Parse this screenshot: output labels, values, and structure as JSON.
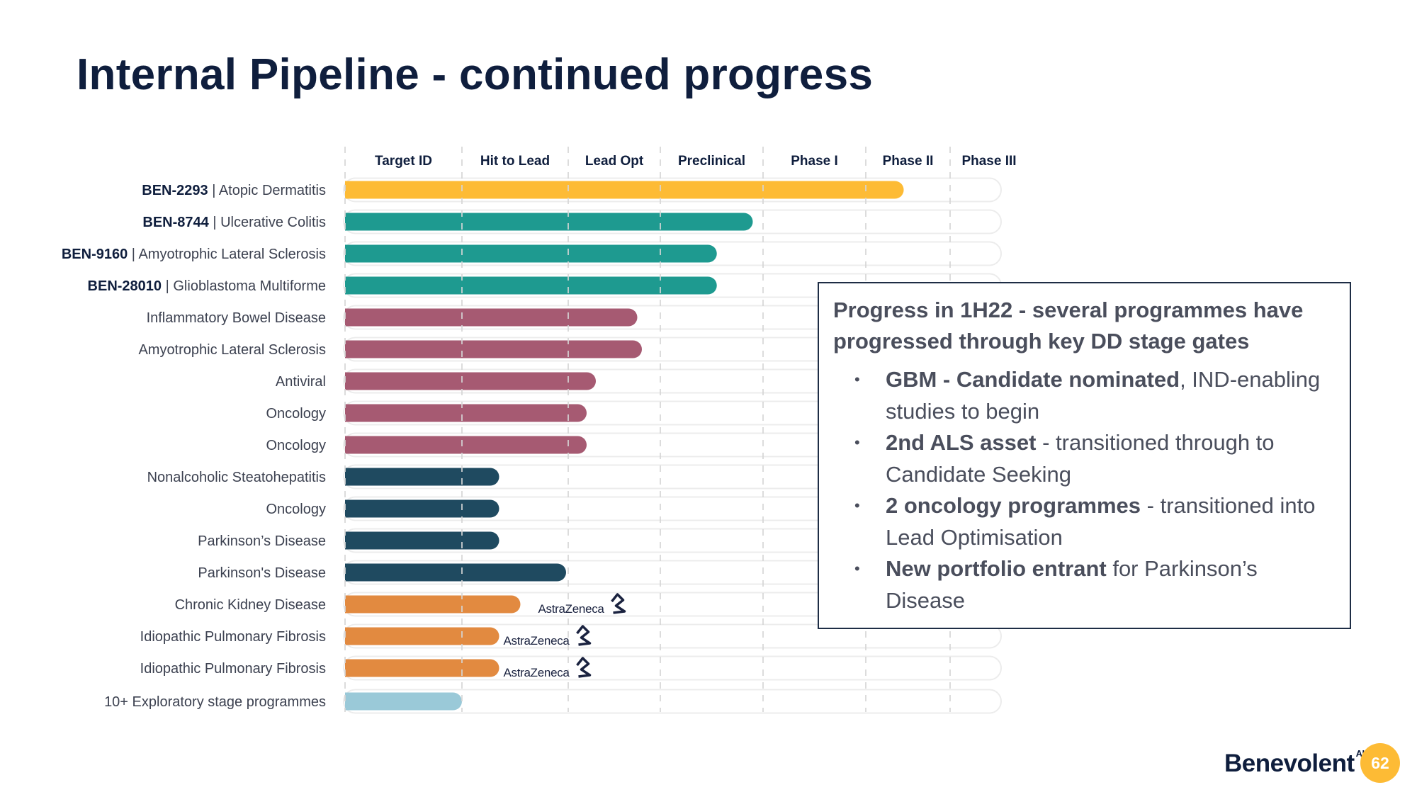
{
  "page": {
    "title": "Internal Pipeline - continued progress",
    "page_number": "62",
    "logo": {
      "name": "Benevolent",
      "superscript": "AI"
    }
  },
  "colors": {
    "title": "#0f1e3d",
    "yellow": "#fdbb35",
    "teal": "#1e9a90",
    "mauve": "#a65a72",
    "navy": "#1f4a60",
    "orange": "#e28a40",
    "lightblue": "#9ac9d8",
    "track": "#ececec",
    "grid": "#d6d6d6"
  },
  "chart_data": {
    "type": "bar",
    "orientation": "horizontal",
    "title": "",
    "stages": [
      "Target ID",
      "Hit to Lead",
      "Lead Opt",
      "Preclinical",
      "Phase I",
      "Phase II",
      "Phase III"
    ],
    "value_unit": "stage progress (0 = start of Target ID, 7 = end of Phase III)",
    "xlim": [
      0,
      7
    ],
    "grid": "dashed vertical lines at stage boundaries",
    "rows": [
      {
        "code": "BEN-2293",
        "label": "Atopic Dermatitis",
        "progress": 5.45,
        "color": "yellow",
        "partner": ""
      },
      {
        "code": "BEN-8744",
        "label": "Ulcerative Colitis",
        "progress": 3.9,
        "color": "teal",
        "partner": ""
      },
      {
        "code": "BEN-9160",
        "label": "Amyotrophic Lateral Sclerosis",
        "progress": 3.55,
        "color": "teal",
        "partner": ""
      },
      {
        "code": "BEN-28010",
        "label": "Glioblastoma Multiforme",
        "progress": 3.55,
        "color": "teal",
        "partner": ""
      },
      {
        "code": "",
        "label": "Inflammatory Bowel Disease",
        "progress": 2.75,
        "color": "mauve",
        "partner": ""
      },
      {
        "code": "",
        "label": "Amyotrophic Lateral Sclerosis",
        "progress": 2.8,
        "color": "mauve",
        "partner": ""
      },
      {
        "code": "",
        "label": "Antiviral",
        "progress": 2.3,
        "color": "mauve",
        "partner": ""
      },
      {
        "code": "",
        "label": "Oncology",
        "progress": 2.2,
        "color": "mauve",
        "partner": ""
      },
      {
        "code": "",
        "label": "Oncology",
        "progress": 2.2,
        "color": "mauve",
        "partner": ""
      },
      {
        "code": "",
        "label": "Nonalcoholic Steatohepatitis",
        "progress": 1.35,
        "color": "navy",
        "partner": ""
      },
      {
        "code": "",
        "label": "Oncology",
        "progress": 1.35,
        "color": "navy",
        "partner": ""
      },
      {
        "code": "",
        "label": "Parkinson’s Disease",
        "progress": 1.35,
        "color": "navy",
        "partner": ""
      },
      {
        "code": "",
        "label": "Parkinson's Disease",
        "progress": 1.98,
        "color": "navy",
        "partner": ""
      },
      {
        "code": "",
        "label": "Chronic Kidney Disease",
        "progress": 1.55,
        "color": "orange",
        "partner": "AstraZeneca"
      },
      {
        "code": "",
        "label": "Idiopathic Pulmonary Fibrosis",
        "progress": 1.35,
        "color": "orange",
        "partner": "AstraZeneca"
      },
      {
        "code": "",
        "label": "Idiopathic Pulmonary Fibrosis",
        "progress": 1.35,
        "color": "orange",
        "partner": "AstraZeneca"
      },
      {
        "code": "",
        "label": "10+ Exploratory stage programmes",
        "progress": 1.0,
        "color": "lightblue",
        "partner": ""
      }
    ]
  },
  "callout": {
    "heading": "Progress in 1H22 - several programmes have progressed through key DD stage gates",
    "bullets": [
      {
        "bold": "GBM - Candidate nominated",
        "rest": ", IND-enabling studies to begin"
      },
      {
        "bold": "2nd ALS asset",
        "rest": " - transitioned through to Candidate Seeking"
      },
      {
        "bold": "2 oncology programmes",
        "rest": " - transitioned into Lead Optimisation"
      },
      {
        "bold": "New portfolio entrant",
        "rest": " for Parkinson’s Disease"
      }
    ],
    "bullet_glyph": "•"
  }
}
